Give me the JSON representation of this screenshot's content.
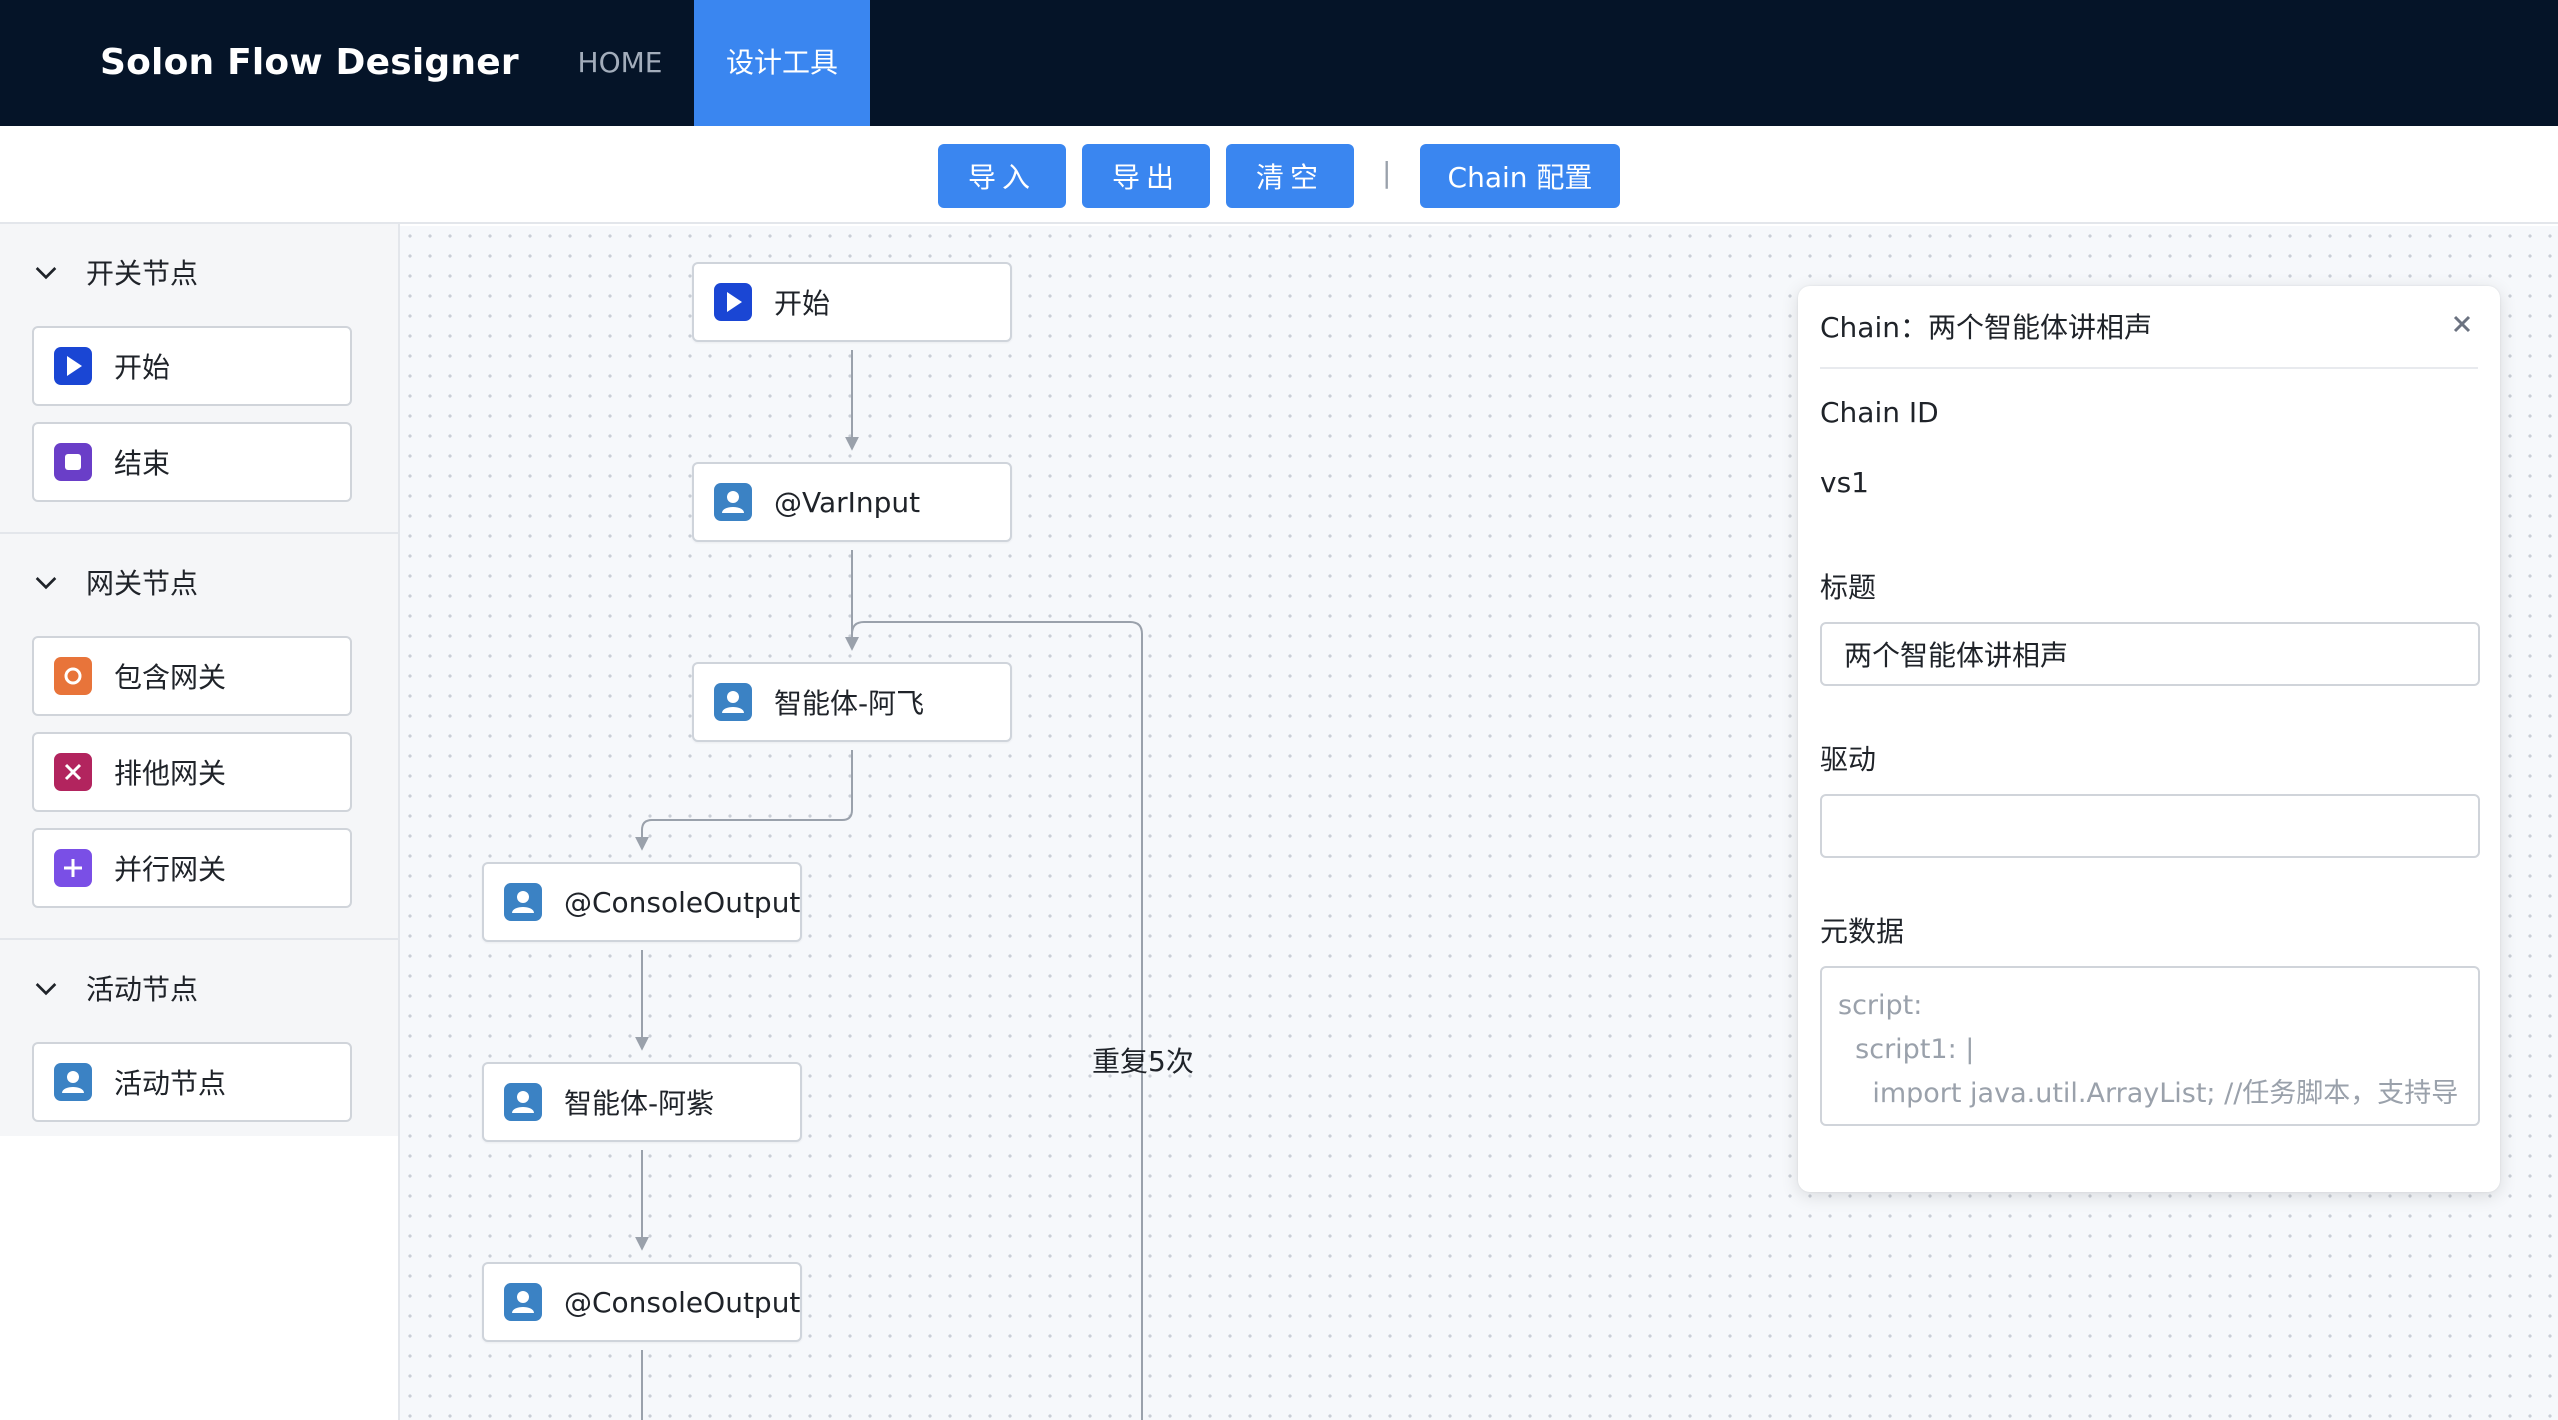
{
  "app": {
    "title": "Solon Flow Designer",
    "nav": [
      {
        "label": "HOME",
        "active": false
      },
      {
        "label": "设计工具",
        "active": true
      }
    ]
  },
  "toolbar": {
    "import_label": "导入",
    "export_label": "导出",
    "clear_label": "清空",
    "separator": "|",
    "chain_config_label": "Chain 配置"
  },
  "sidebar": {
    "groups": [
      {
        "label": "开关节点",
        "items": [
          {
            "label": "开始",
            "icon": "play-icon"
          },
          {
            "label": "结束",
            "icon": "stop-icon"
          }
        ]
      },
      {
        "label": "网关节点",
        "items": [
          {
            "label": "包含网关",
            "icon": "circle-gateway-icon"
          },
          {
            "label": "排他网关",
            "icon": "x-gateway-icon"
          },
          {
            "label": "并行网关",
            "icon": "plus-gateway-icon"
          }
        ]
      },
      {
        "label": "活动节点",
        "items": [
          {
            "label": "活动节点",
            "icon": "user-icon"
          }
        ]
      }
    ]
  },
  "canvas": {
    "nodes": [
      {
        "label": "开始",
        "icon": "play-icon"
      },
      {
        "label": "@VarInput",
        "icon": "user-icon"
      },
      {
        "label": "智能体-阿飞",
        "icon": "user-icon"
      },
      {
        "label": "@ConsoleOutput",
        "icon": "user-icon"
      },
      {
        "label": "智能体-阿紫",
        "icon": "user-icon"
      },
      {
        "label": "@ConsoleOutput",
        "icon": "user-icon"
      }
    ],
    "loop_label": "重复5次"
  },
  "properties": {
    "title": "Chain：两个智能体讲相声",
    "chain_id_label": "Chain ID",
    "chain_id_value": "vs1",
    "title_label": "标题",
    "title_value": "两个智能体讲相声",
    "driver_label": "驱动",
    "driver_value": "",
    "meta_label": "元数据",
    "meta_placeholder": "script:\n  script1: |\n    import java.util.ArrayList; //任务脚本，支持导"
  },
  "colors": {
    "nav_bg": "#051428",
    "accent": "#3a86f0",
    "play": "#1a46d4",
    "stop": "#6a3ec8",
    "inclusive": "#e8743a",
    "exclusive": "#b2245e",
    "parallel": "#7a4fe6",
    "activity": "#3b82c4"
  }
}
